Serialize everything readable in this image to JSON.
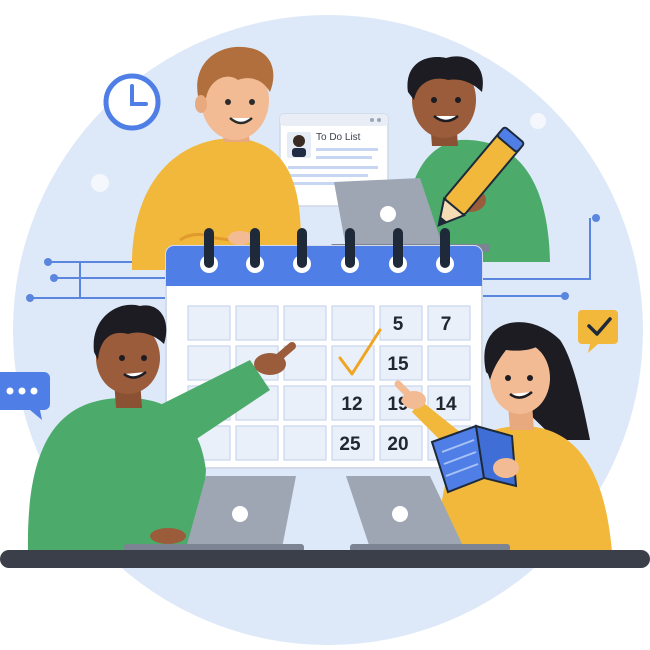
{
  "todo_window": {
    "title": "To Do List"
  },
  "calendar": {
    "numbers": [
      "5",
      "7",
      "15",
      "12",
      "19",
      "14",
      "25",
      "20"
    ]
  },
  "icons": [
    "clock-icon",
    "chat-bubble-icon",
    "checkmark-badge-icon",
    "checkmark-icon"
  ],
  "colors": {
    "background_circle": "#dde9f8",
    "calendar_header": "#4f7fe6",
    "green_shirt": "#4cab6b",
    "yellow_shirt": "#f2b83b",
    "check": "#f0a521",
    "desk": "#3a3f4a"
  }
}
